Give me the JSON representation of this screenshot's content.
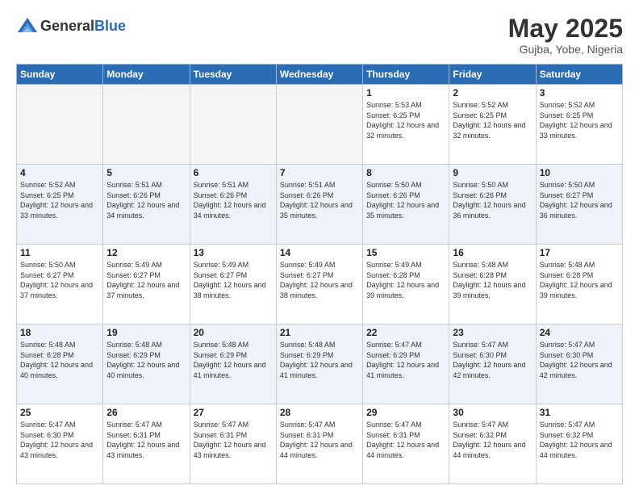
{
  "header": {
    "logo_general": "General",
    "logo_blue": "Blue",
    "month": "May 2025",
    "location": "Gujba, Yobe, Nigeria"
  },
  "days_of_week": [
    "Sunday",
    "Monday",
    "Tuesday",
    "Wednesday",
    "Thursday",
    "Friday",
    "Saturday"
  ],
  "weeks": [
    [
      {
        "day": "",
        "empty": true
      },
      {
        "day": "",
        "empty": true
      },
      {
        "day": "",
        "empty": true
      },
      {
        "day": "",
        "empty": true
      },
      {
        "day": "1",
        "sunrise": "5:53 AM",
        "sunset": "6:25 PM",
        "daylight": "12 hours and 32 minutes."
      },
      {
        "day": "2",
        "sunrise": "5:52 AM",
        "sunset": "6:25 PM",
        "daylight": "12 hours and 32 minutes."
      },
      {
        "day": "3",
        "sunrise": "5:52 AM",
        "sunset": "6:25 PM",
        "daylight": "12 hours and 33 minutes."
      }
    ],
    [
      {
        "day": "4",
        "sunrise": "5:52 AM",
        "sunset": "6:25 PM",
        "daylight": "12 hours and 33 minutes."
      },
      {
        "day": "5",
        "sunrise": "5:51 AM",
        "sunset": "6:26 PM",
        "daylight": "12 hours and 34 minutes."
      },
      {
        "day": "6",
        "sunrise": "5:51 AM",
        "sunset": "6:26 PM",
        "daylight": "12 hours and 34 minutes."
      },
      {
        "day": "7",
        "sunrise": "5:51 AM",
        "sunset": "6:26 PM",
        "daylight": "12 hours and 35 minutes."
      },
      {
        "day": "8",
        "sunrise": "5:50 AM",
        "sunset": "6:26 PM",
        "daylight": "12 hours and 35 minutes."
      },
      {
        "day": "9",
        "sunrise": "5:50 AM",
        "sunset": "6:26 PM",
        "daylight": "12 hours and 36 minutes."
      },
      {
        "day": "10",
        "sunrise": "5:50 AM",
        "sunset": "6:27 PM",
        "daylight": "12 hours and 36 minutes."
      }
    ],
    [
      {
        "day": "11",
        "sunrise": "5:50 AM",
        "sunset": "6:27 PM",
        "daylight": "12 hours and 37 minutes."
      },
      {
        "day": "12",
        "sunrise": "5:49 AM",
        "sunset": "6:27 PM",
        "daylight": "12 hours and 37 minutes."
      },
      {
        "day": "13",
        "sunrise": "5:49 AM",
        "sunset": "6:27 PM",
        "daylight": "12 hours and 38 minutes."
      },
      {
        "day": "14",
        "sunrise": "5:49 AM",
        "sunset": "6:27 PM",
        "daylight": "12 hours and 38 minutes."
      },
      {
        "day": "15",
        "sunrise": "5:49 AM",
        "sunset": "6:28 PM",
        "daylight": "12 hours and 39 minutes."
      },
      {
        "day": "16",
        "sunrise": "5:48 AM",
        "sunset": "6:28 PM",
        "daylight": "12 hours and 39 minutes."
      },
      {
        "day": "17",
        "sunrise": "5:48 AM",
        "sunset": "6:28 PM",
        "daylight": "12 hours and 39 minutes."
      }
    ],
    [
      {
        "day": "18",
        "sunrise": "5:48 AM",
        "sunset": "6:28 PM",
        "daylight": "12 hours and 40 minutes."
      },
      {
        "day": "19",
        "sunrise": "5:48 AM",
        "sunset": "6:29 PM",
        "daylight": "12 hours and 40 minutes."
      },
      {
        "day": "20",
        "sunrise": "5:48 AM",
        "sunset": "6:29 PM",
        "daylight": "12 hours and 41 minutes."
      },
      {
        "day": "21",
        "sunrise": "5:48 AM",
        "sunset": "6:29 PM",
        "daylight": "12 hours and 41 minutes."
      },
      {
        "day": "22",
        "sunrise": "5:47 AM",
        "sunset": "6:29 PM",
        "daylight": "12 hours and 41 minutes."
      },
      {
        "day": "23",
        "sunrise": "5:47 AM",
        "sunset": "6:30 PM",
        "daylight": "12 hours and 42 minutes."
      },
      {
        "day": "24",
        "sunrise": "5:47 AM",
        "sunset": "6:30 PM",
        "daylight": "12 hours and 42 minutes."
      }
    ],
    [
      {
        "day": "25",
        "sunrise": "5:47 AM",
        "sunset": "6:30 PM",
        "daylight": "12 hours and 43 minutes."
      },
      {
        "day": "26",
        "sunrise": "5:47 AM",
        "sunset": "6:31 PM",
        "daylight": "12 hours and 43 minutes."
      },
      {
        "day": "27",
        "sunrise": "5:47 AM",
        "sunset": "6:31 PM",
        "daylight": "12 hours and 43 minutes."
      },
      {
        "day": "28",
        "sunrise": "5:47 AM",
        "sunset": "6:31 PM",
        "daylight": "12 hours and 44 minutes."
      },
      {
        "day": "29",
        "sunrise": "5:47 AM",
        "sunset": "6:31 PM",
        "daylight": "12 hours and 44 minutes."
      },
      {
        "day": "30",
        "sunrise": "5:47 AM",
        "sunset": "6:32 PM",
        "daylight": "12 hours and 44 minutes."
      },
      {
        "day": "31",
        "sunrise": "5:47 AM",
        "sunset": "6:32 PM",
        "daylight": "12 hours and 44 minutes."
      }
    ]
  ],
  "labels": {
    "sunrise": "Sunrise:",
    "sunset": "Sunset:",
    "daylight": "Daylight hours"
  }
}
